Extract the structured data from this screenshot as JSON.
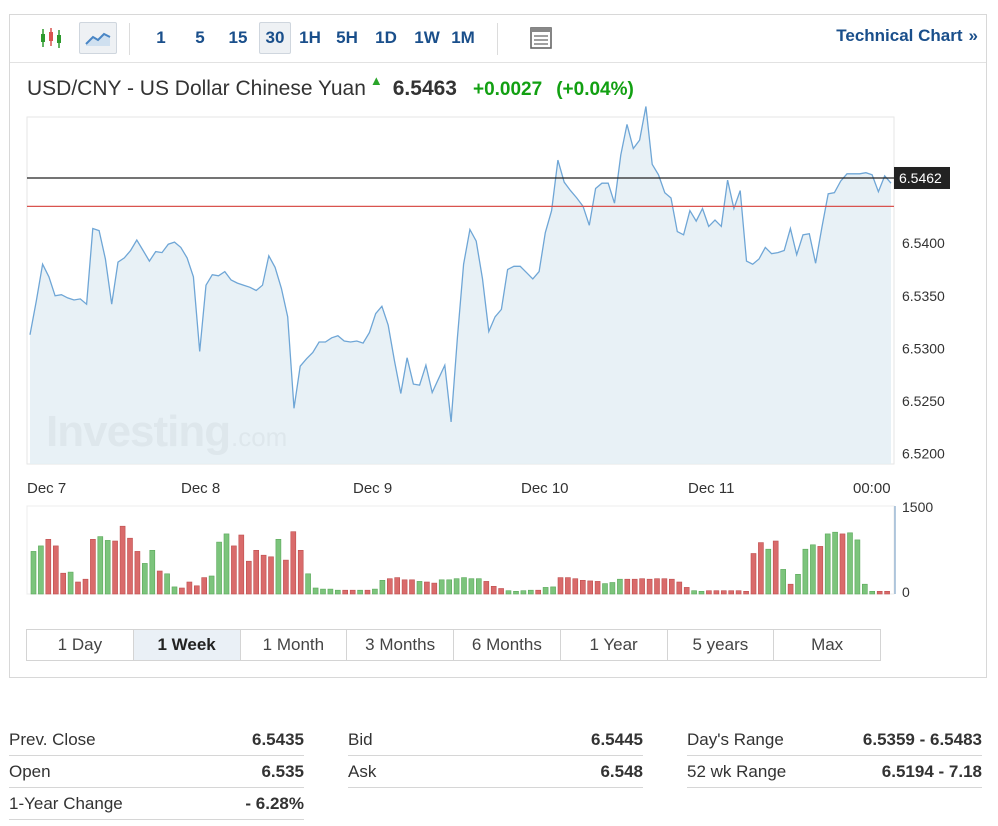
{
  "toolbar": {
    "candle_icon": "candlestick-icon",
    "area_icon": "area-chart-icon",
    "table_icon": "table-view-icon",
    "intervals": [
      "1",
      "5",
      "15",
      "30",
      "1H",
      "5H",
      "1D",
      "1W",
      "1M"
    ],
    "active_interval": "30",
    "tech_link": "Technical Chart",
    "tech_chevron": "»"
  },
  "quote": {
    "name": "USD/CNY - US Dollar Chinese Yuan",
    "direction_icon": "up-arrow-icon",
    "price": "6.5463",
    "change": "+0.0027",
    "change_pct": "(+0.04%)",
    "up_color": "#12a012"
  },
  "chart_data": {
    "type": "area",
    "price_axis": {
      "ticks": [
        "6.5200",
        "6.5250",
        "6.5300",
        "6.5350",
        "6.5400"
      ],
      "ylim": [
        6.519,
        6.552
      ]
    },
    "time_axis": {
      "ticks": [
        "Dec 7",
        "Dec 8",
        "Dec 9",
        "Dec 10",
        "Dec 11",
        "00:00"
      ]
    },
    "last_price_label": "6.5462",
    "last_price_line": 6.5462,
    "prev_close_line": 6.5435,
    "watermark": "Investing",
    "watermark_suffix": ".com",
    "colors": {
      "line": "#6fa6d6",
      "fill": "#e4eef5",
      "last_line": "#222222",
      "prev_close": "#d9534f",
      "vol_up": "#7cc47c",
      "vol_down": "#d96b6b"
    },
    "prices": [
      6.5313,
      6.5345,
      6.538,
      6.5368,
      6.535,
      6.5351,
      6.5348,
      6.5346,
      6.5347,
      6.5342,
      6.5414,
      6.5412,
      6.5385,
      6.5342,
      6.5382,
      6.5386,
      6.5393,
      6.5403,
      6.5393,
      6.5383,
      6.5392,
      6.5391,
      6.5399,
      6.5401,
      6.5396,
      6.5386,
      6.5368,
      6.5297,
      6.536,
      6.537,
      6.5369,
      6.5373,
      6.5365,
      6.5362,
      6.536,
      6.5358,
      6.5355,
      6.536,
      6.5388,
      6.5377,
      6.5357,
      6.533,
      6.5243,
      6.5283,
      6.529,
      6.5296,
      6.5306,
      6.5306,
      6.531,
      6.5312,
      6.5307,
      6.5306,
      6.5307,
      6.5305,
      6.5315,
      6.5333,
      6.534,
      6.5322,
      6.5288,
      6.5257,
      6.5291,
      6.5266,
      6.5265,
      6.5284,
      6.5258,
      6.5271,
      6.5284,
      6.523,
      6.531,
      6.538,
      6.5413,
      6.5402,
      6.5366,
      6.5316,
      6.533,
      6.5337,
      6.5375,
      6.5378,
      6.5378,
      6.5372,
      6.5366,
      6.5373,
      6.541,
      6.5431,
      6.5479,
      6.5458,
      6.545,
      6.5443,
      6.5435,
      6.5417,
      6.5452,
      6.5457,
      6.5457,
      6.5438,
      6.5484,
      6.5513,
      6.549,
      6.5498,
      6.553,
      6.5475,
      6.5465,
      6.5448,
      6.5443,
      6.5411,
      6.5408,
      6.5431,
      6.5421,
      6.5433,
      6.5416,
      6.5422,
      6.5416,
      6.546,
      6.5433,
      6.545,
      6.5383,
      6.538,
      6.5385,
      6.5396,
      6.539,
      6.5391,
      6.5393,
      6.5414,
      6.5389,
      6.5408,
      6.5409,
      6.5381,
      6.5415,
      6.5447,
      6.5448,
      6.5459,
      6.5466,
      6.5466,
      6.5466,
      6.5467,
      6.5465,
      6.5449,
      6.5464,
      6.5457
    ],
    "volume_axis": {
      "ticks": [
        "1500",
        "0"
      ],
      "max": 1500
    },
    "volumes": [
      {
        "v": 780,
        "d": "up"
      },
      {
        "v": 880,
        "d": "up"
      },
      {
        "v": 1000,
        "d": "down"
      },
      {
        "v": 880,
        "d": "down"
      },
      {
        "v": 380,
        "d": "down"
      },
      {
        "v": 400,
        "d": "up"
      },
      {
        "v": 220,
        "d": "down"
      },
      {
        "v": 270,
        "d": "down"
      },
      {
        "v": 1000,
        "d": "down"
      },
      {
        "v": 1050,
        "d": "up"
      },
      {
        "v": 980,
        "d": "up"
      },
      {
        "v": 970,
        "d": "down"
      },
      {
        "v": 1240,
        "d": "down"
      },
      {
        "v": 1020,
        "d": "down"
      },
      {
        "v": 780,
        "d": "down"
      },
      {
        "v": 560,
        "d": "up"
      },
      {
        "v": 800,
        "d": "up"
      },
      {
        "v": 420,
        "d": "down"
      },
      {
        "v": 370,
        "d": "up"
      },
      {
        "v": 130,
        "d": "up"
      },
      {
        "v": 110,
        "d": "down"
      },
      {
        "v": 220,
        "d": "down"
      },
      {
        "v": 150,
        "d": "down"
      },
      {
        "v": 300,
        "d": "down"
      },
      {
        "v": 330,
        "d": "up"
      },
      {
        "v": 950,
        "d": "up"
      },
      {
        "v": 1100,
        "d": "up"
      },
      {
        "v": 880,
        "d": "down"
      },
      {
        "v": 1080,
        "d": "down"
      },
      {
        "v": 600,
        "d": "down"
      },
      {
        "v": 800,
        "d": "down"
      },
      {
        "v": 710,
        "d": "down"
      },
      {
        "v": 680,
        "d": "down"
      },
      {
        "v": 1000,
        "d": "up"
      },
      {
        "v": 620,
        "d": "down"
      },
      {
        "v": 1140,
        "d": "down"
      },
      {
        "v": 800,
        "d": "down"
      },
      {
        "v": 370,
        "d": "up"
      },
      {
        "v": 110,
        "d": "up"
      },
      {
        "v": 90,
        "d": "up"
      },
      {
        "v": 90,
        "d": "up"
      },
      {
        "v": 70,
        "d": "up"
      },
      {
        "v": 70,
        "d": "down"
      },
      {
        "v": 70,
        "d": "down"
      },
      {
        "v": 70,
        "d": "up"
      },
      {
        "v": 70,
        "d": "down"
      },
      {
        "v": 90,
        "d": "up"
      },
      {
        "v": 250,
        "d": "up"
      },
      {
        "v": 280,
        "d": "down"
      },
      {
        "v": 300,
        "d": "down"
      },
      {
        "v": 260,
        "d": "down"
      },
      {
        "v": 260,
        "d": "down"
      },
      {
        "v": 230,
        "d": "up"
      },
      {
        "v": 220,
        "d": "down"
      },
      {
        "v": 200,
        "d": "down"
      },
      {
        "v": 260,
        "d": "up"
      },
      {
        "v": 260,
        "d": "up"
      },
      {
        "v": 280,
        "d": "up"
      },
      {
        "v": 300,
        "d": "up"
      },
      {
        "v": 280,
        "d": "up"
      },
      {
        "v": 280,
        "d": "up"
      },
      {
        "v": 230,
        "d": "down"
      },
      {
        "v": 140,
        "d": "down"
      },
      {
        "v": 100,
        "d": "down"
      },
      {
        "v": 60,
        "d": "up"
      },
      {
        "v": 50,
        "d": "up"
      },
      {
        "v": 60,
        "d": "up"
      },
      {
        "v": 70,
        "d": "up"
      },
      {
        "v": 70,
        "d": "down"
      },
      {
        "v": 120,
        "d": "up"
      },
      {
        "v": 130,
        "d": "up"
      },
      {
        "v": 300,
        "d": "down"
      },
      {
        "v": 300,
        "d": "down"
      },
      {
        "v": 280,
        "d": "down"
      },
      {
        "v": 250,
        "d": "down"
      },
      {
        "v": 240,
        "d": "down"
      },
      {
        "v": 230,
        "d": "down"
      },
      {
        "v": 190,
        "d": "up"
      },
      {
        "v": 210,
        "d": "up"
      },
      {
        "v": 270,
        "d": "up"
      },
      {
        "v": 270,
        "d": "down"
      },
      {
        "v": 270,
        "d": "down"
      },
      {
        "v": 280,
        "d": "down"
      },
      {
        "v": 270,
        "d": "down"
      },
      {
        "v": 280,
        "d": "down"
      },
      {
        "v": 280,
        "d": "down"
      },
      {
        "v": 270,
        "d": "down"
      },
      {
        "v": 220,
        "d": "down"
      },
      {
        "v": 120,
        "d": "down"
      },
      {
        "v": 60,
        "d": "up"
      },
      {
        "v": 50,
        "d": "up"
      },
      {
        "v": 60,
        "d": "down"
      },
      {
        "v": 60,
        "d": "down"
      },
      {
        "v": 60,
        "d": "down"
      },
      {
        "v": 60,
        "d": "down"
      },
      {
        "v": 60,
        "d": "down"
      },
      {
        "v": 50,
        "d": "down"
      },
      {
        "v": 740,
        "d": "down"
      },
      {
        "v": 940,
        "d": "down"
      },
      {
        "v": 820,
        "d": "up"
      },
      {
        "v": 970,
        "d": "down"
      },
      {
        "v": 450,
        "d": "up"
      },
      {
        "v": 180,
        "d": "down"
      },
      {
        "v": 360,
        "d": "up"
      },
      {
        "v": 820,
        "d": "up"
      },
      {
        "v": 900,
        "d": "up"
      },
      {
        "v": 870,
        "d": "down"
      },
      {
        "v": 1100,
        "d": "up"
      },
      {
        "v": 1130,
        "d": "up"
      },
      {
        "v": 1100,
        "d": "down"
      },
      {
        "v": 1120,
        "d": "up"
      },
      {
        "v": 990,
        "d": "up"
      },
      {
        "v": 180,
        "d": "up"
      },
      {
        "v": 50,
        "d": "up"
      },
      {
        "v": 50,
        "d": "down"
      },
      {
        "v": 50,
        "d": "down"
      }
    ]
  },
  "range_tabs": [
    "1 Day",
    "1 Week",
    "1 Month",
    "3 Months",
    "6 Months",
    "1 Year",
    "5 years",
    "Max"
  ],
  "active_range": "1 Week",
  "stats": {
    "col1": [
      {
        "label": "Prev. Close",
        "value": "6.5435"
      },
      {
        "label": "Open",
        "value": "6.535"
      },
      {
        "label": "1-Year Change",
        "value": "- 6.28%"
      }
    ],
    "col2": [
      {
        "label": "Bid",
        "value": "6.5445"
      },
      {
        "label": "Ask",
        "value": "6.548"
      }
    ],
    "col3": [
      {
        "label": "Day's Range",
        "value": "6.5359 - 6.5483"
      },
      {
        "label": "52 wk Range",
        "value": "6.5194 - 7.18"
      }
    ]
  }
}
